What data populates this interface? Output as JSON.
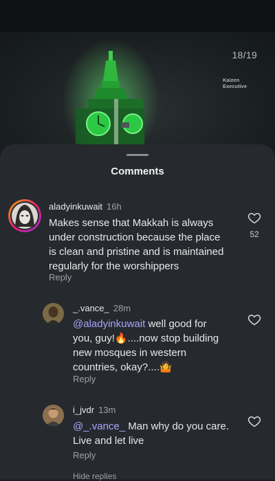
{
  "photo": {
    "counter": "18/19",
    "watermark_line1": "Kaizen",
    "watermark_line2": "Executive"
  },
  "sheet": {
    "title": "Comments"
  },
  "comments": [
    {
      "username": "aladyinkuwait",
      "time": "16h",
      "lines": [
        "Makes sense that Makkah is always",
        "under construction because the place",
        "is clean and pristine and is maintained",
        "regularly for the worshippers"
      ],
      "reply_label": "Reply",
      "likes": "52"
    }
  ],
  "replies": [
    {
      "username": "_.vance_",
      "time": "28m",
      "mention": "@aladyinkuwait",
      "line1_rest": " well good for",
      "line2": "you, guy!🔥....now stop building",
      "line3": "new mosques in western",
      "line4": "countries, okay?....🤷",
      "reply_label": "Reply"
    },
    {
      "username": "i_jvdr",
      "time": "13m",
      "mention": "@_.vance_",
      "line1_rest": " Man why do you care.",
      "line2": "Live and let live",
      "reply_label": "Reply"
    }
  ],
  "hide_replies": "Hide replies",
  "colors": {
    "sheet": "#26292e",
    "mention": "#a8a6ff",
    "tower_glow": "#39c24a"
  },
  "icons": {
    "like": "heart-icon"
  }
}
